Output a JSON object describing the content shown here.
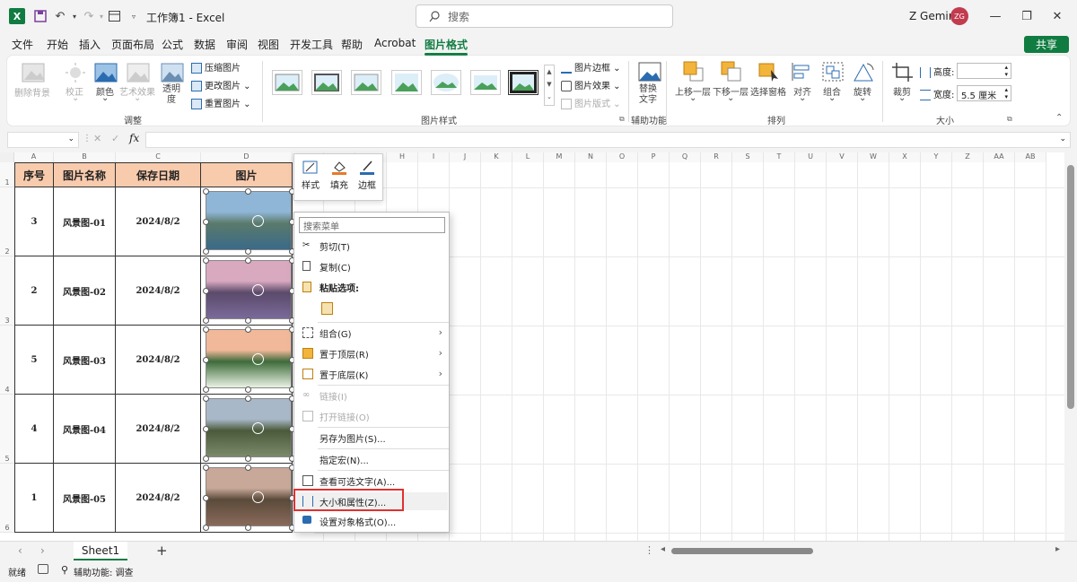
{
  "window": {
    "title": "工作簿1 - Excel",
    "search_placeholder": "搜索",
    "user": "Z Gemini",
    "avatar": "ZG",
    "share": "共享"
  },
  "menu": [
    "文件",
    "开始",
    "插入",
    "页面布局",
    "公式",
    "数据",
    "审阅",
    "视图",
    "开发工具",
    "帮助",
    "Acrobat",
    "图片格式"
  ],
  "menu_active": "图片格式",
  "ribbon": {
    "remove_bg": "删除背景",
    "correct": "校正",
    "color": "颜色",
    "art_effects": "艺术效果",
    "transparency": "透明度",
    "compress": "压缩图片",
    "change": "更改图片",
    "reset": "重置图片",
    "group_adjust": "调整",
    "group_styles": "图片样式",
    "border": "图片边框",
    "effects": "图片效果",
    "layout": "图片版式",
    "alt_text": "替换文字",
    "group_access": "辅助功能",
    "bring_forward": "上移一层",
    "send_backward": "下移一层",
    "selection_pane": "选择窗格",
    "align": "对齐",
    "group": "组合",
    "rotate": "旋转",
    "group_arrange": "排列",
    "crop": "裁剪",
    "height_lbl": "高度:",
    "height_val": "",
    "width_lbl": "宽度:",
    "width_val": "5.5 厘米",
    "group_size": "大小"
  },
  "formula": {
    "fx": "fx"
  },
  "columns": [
    "A",
    "B",
    "C",
    "D",
    "E",
    "F",
    "G",
    "H",
    "I",
    "J",
    "K",
    "L",
    "M",
    "N",
    "O",
    "P",
    "Q",
    "R",
    "S",
    "T",
    "U",
    "V",
    "W",
    "X",
    "Y",
    "Z",
    "AA",
    "AB"
  ],
  "table": {
    "headers": [
      "序号",
      "图片名称",
      "保存日期",
      "图片"
    ],
    "rows": [
      {
        "no": "3",
        "name": "风景图-01",
        "date": "2024/8/2"
      },
      {
        "no": "2",
        "name": "风景图-02",
        "date": "2024/8/2"
      },
      {
        "no": "5",
        "name": "风景图-03",
        "date": "2024/8/2"
      },
      {
        "no": "4",
        "name": "风景图-04",
        "date": "2024/8/2"
      },
      {
        "no": "1",
        "name": "风景图-05",
        "date": "2024/8/2"
      }
    ],
    "row_numbers": [
      "1",
      "2",
      "3",
      "4",
      "5",
      "6"
    ]
  },
  "mini_toolbar": {
    "style": "样式",
    "fill": "填充",
    "border": "边框"
  },
  "context_menu": {
    "search": "搜索菜单",
    "cut": "剪切(T)",
    "copy": "复制(C)",
    "paste_options": "粘贴选项:",
    "group": "组合(G)",
    "bring_front": "置于顶层(R)",
    "send_back": "置于底层(K)",
    "link": "链接(I)",
    "open_link": "打开链接(O)",
    "save_as": "另存为图片(S)...",
    "macro": "指定宏(N)...",
    "alt_text": "查看可选文字(A)...",
    "size_props": "大小和属性(Z)...",
    "format_obj": "设置对象格式(O)..."
  },
  "sheet": {
    "tab": "Sheet1",
    "add": "+"
  },
  "status": {
    "ready": "就绪",
    "accessibility": "辅助功能: 调查"
  },
  "colors": {
    "accent": "#107c41",
    "header_fill": "#f8cbad",
    "highlight": "#e03030"
  }
}
